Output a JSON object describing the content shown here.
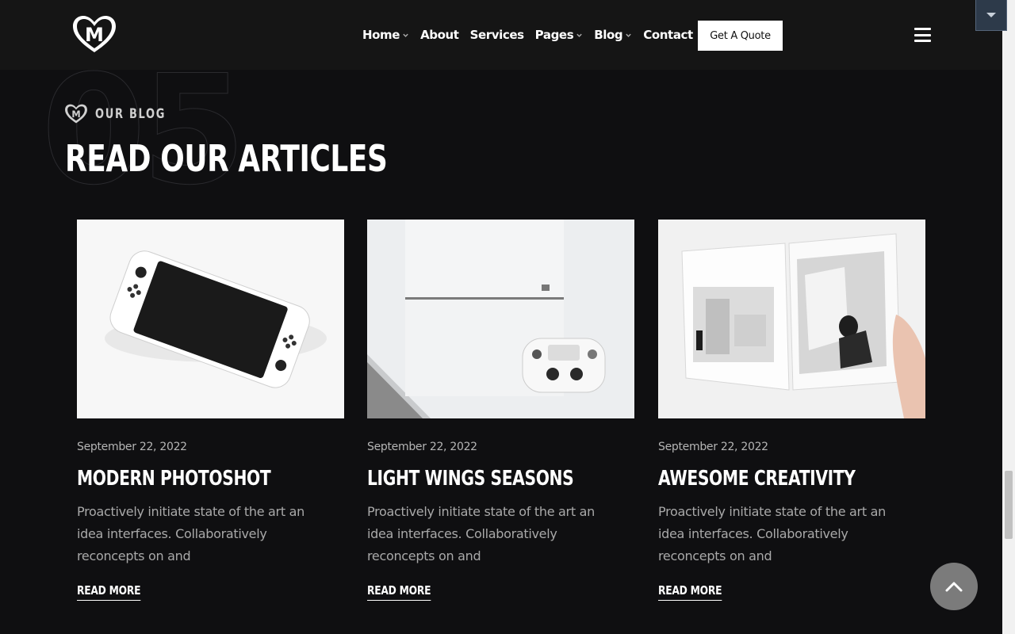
{
  "header": {
    "logo_letter": "M",
    "nav": [
      {
        "label": "Home",
        "has_dropdown": true
      },
      {
        "label": "About",
        "has_dropdown": false
      },
      {
        "label": "Services",
        "has_dropdown": false
      },
      {
        "label": "Pages",
        "has_dropdown": true
      },
      {
        "label": "Blog",
        "has_dropdown": true
      },
      {
        "label": "Contact",
        "has_dropdown": false
      }
    ],
    "cta_label": "Get A Quote"
  },
  "section": {
    "number": "05",
    "eyebrow": "OUR BLOG",
    "title": "READ OUR ARTICLES"
  },
  "posts": [
    {
      "date": "September 22, 2022",
      "title": "MODERN PHOTOSHOT",
      "excerpt": "Proactively initiate state of the art an idea interfaces. Collaboratively reconcepts on and",
      "link": "READ MORE",
      "image_icon": "handheld-console-photo"
    },
    {
      "date": "September 22, 2022",
      "title": "LIGHT WINGS SEASONS",
      "excerpt": "Proactively initiate state of the art an idea interfaces. Collaboratively reconcepts on and",
      "link": "READ MORE",
      "image_icon": "console-and-controller-photo"
    },
    {
      "date": "September 22, 2022",
      "title": "AWESOME CREATIVITY",
      "excerpt": "Proactively initiate state of the art an idea interfaces. Collaboratively reconcepts on and",
      "link": "READ MORE",
      "image_icon": "open-magazine-photo"
    }
  ],
  "colors": {
    "background": "#0f0f11",
    "header": "#151515",
    "text_muted": "#a9a9a9"
  }
}
